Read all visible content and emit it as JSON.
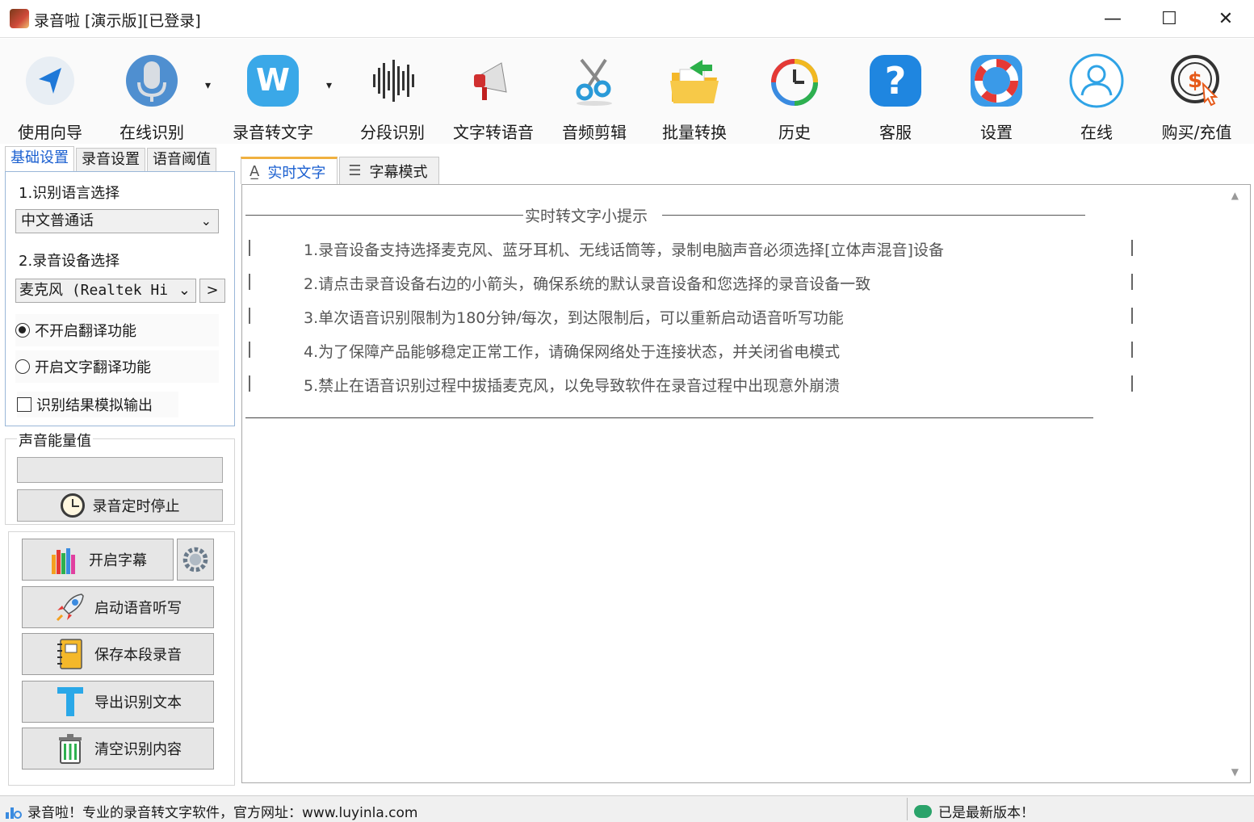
{
  "window": {
    "title": "录音啦 [演示版][已登录]",
    "minimize": "—",
    "maximize": "☐",
    "close": "✕"
  },
  "toolbar": {
    "items": [
      {
        "label": "使用向导",
        "icon": "navigation-arrow-icon"
      },
      {
        "label": "在线识别",
        "icon": "microphone-icon",
        "dropdown": "▾"
      },
      {
        "label": "录音转文字",
        "icon": "w-logo-icon",
        "dropdown": "▾"
      },
      {
        "label": "分段识别",
        "icon": "waveform-icon"
      },
      {
        "label": "文字转语音",
        "icon": "megaphone-icon"
      },
      {
        "label": "音频剪辑",
        "icon": "scissors-icon"
      },
      {
        "label": "批量转换",
        "icon": "folder-icon"
      },
      {
        "label": "历史",
        "icon": "history-clock-icon"
      },
      {
        "label": "客服",
        "icon": "help-icon"
      },
      {
        "label": "设置",
        "icon": "lifebuoy-icon"
      },
      {
        "label": "在线",
        "icon": "user-icon"
      },
      {
        "label": "购买/充值",
        "icon": "dollar-coin-icon"
      }
    ]
  },
  "left_panel": {
    "tabs": [
      "基础设置",
      "录音设置",
      "语音阈值"
    ],
    "language_label": "1.识别语言选择",
    "language_value": "中文普通话",
    "device_label": "2.录音设备选择",
    "device_value": "麦克风 (Realtek Hi",
    "device_next": ">",
    "radio_no_translate": "不开启翻译功能",
    "radio_translate": "开启文字翻译功能",
    "checkbox_simulate": "识别结果模拟输出",
    "energy_title": "声音能量值",
    "timer_button": "录音定时停止",
    "actions": {
      "subtitle": "开启字幕",
      "dictation": "启动语音听写",
      "save": "保存本段录音",
      "export": "导出识别文本",
      "clear": "清空识别内容"
    }
  },
  "right_panel": {
    "tabs": [
      "实时文字",
      "字幕模式"
    ],
    "hint_title": "实时转文字小提示",
    "hints": [
      "1.录音设备支持选择麦克风、蓝牙耳机、无线话筒等，录制电脑声音必须选择[立体声混音]设备",
      "2.请点击录音设备右边的小箭头，确保系统的默认录音设备和您选择的录音设备一致",
      "3.单次语音识别限制为180分钟/每次，到达限制后，可以重新启动语音听写功能",
      "4.为了保障产品能够稳定正常工作，请确保网络处于连接状态，并关闭省电模式",
      "5.禁止在语音识别过程中拔插麦克风，以免导致软件在录音过程中出现意外崩溃"
    ]
  },
  "statusbar": {
    "left_text": "录音啦！专业的录音转文字软件，官方网址：www.luyinla.com",
    "right_text": "已是最新版本！"
  },
  "colors": {
    "accent_blue": "#1a5fd0",
    "tab_highlight": "#f0b040",
    "status_green": "#2aa36a"
  }
}
